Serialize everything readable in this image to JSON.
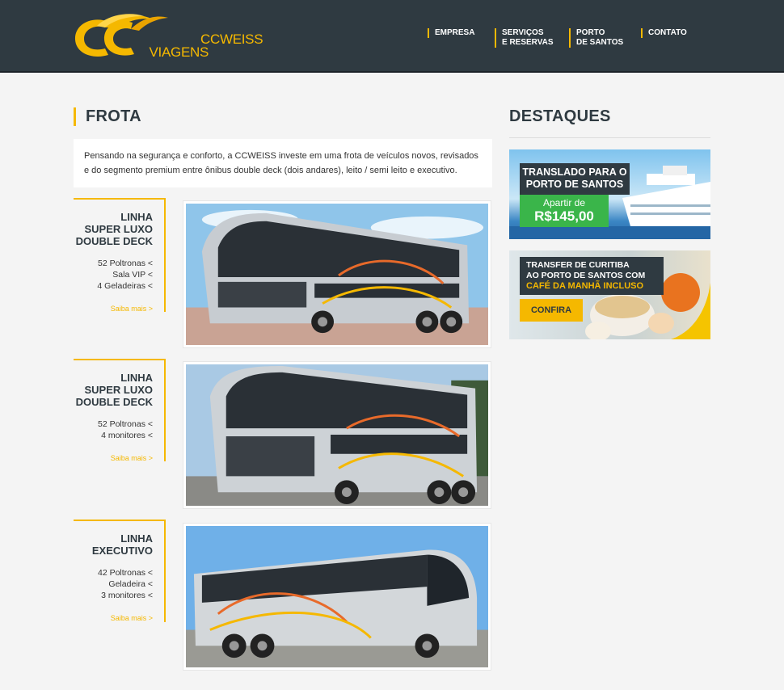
{
  "brand": {
    "logo_line1": "CCWEISS",
    "logo_line2": "VIAGENS"
  },
  "nav": [
    {
      "line1": "EMPRESA",
      "line2": ""
    },
    {
      "line1": "SERVIÇOS",
      "line2": "E RESERVAS"
    },
    {
      "line1": "PORTO",
      "line2": "DE SANTOS"
    },
    {
      "line1": "CONTATO",
      "line2": ""
    }
  ],
  "frota": {
    "title": "FROTA",
    "intro": "Pensando na segurança e conforto, a CCWEISS investe em uma frota de veículos novos, revisados e do segmento premium entre ônibus double deck (dois andares), leito / semi leito e executivo.",
    "items": [
      {
        "name": [
          "LINHA",
          "SUPER LUXO",
          "DOUBLE DECK"
        ],
        "features": [
          "52 Poltronas <",
          "Sala VIP <",
          "4 Geladeiras <"
        ],
        "more": "Saiba mais >"
      },
      {
        "name": [
          "LINHA",
          "SUPER LUXO",
          "DOUBLE DECK"
        ],
        "features": [
          "52 Poltronas <",
          "4 monitores <"
        ],
        "more": "Saiba mais >"
      },
      {
        "name": [
          "LINHA",
          "EXECUTIVO"
        ],
        "features": [
          "42 Poltronas <",
          "Geladeira <",
          "3 monitores <"
        ],
        "more": "Saiba mais >"
      }
    ]
  },
  "destaques": {
    "title": "DESTAQUES",
    "banner1": {
      "title_line1": "TRANSLADO PARA O",
      "title_line2": "PORTO DE SANTOS",
      "price_label": "Apartir de",
      "price": "R$145,00"
    },
    "banner2": {
      "line1": "TRANSFER DE CURITIBA",
      "line2": "AO PORTO DE SANTOS COM",
      "line3": "CAFÉ DA MANHÃ INCLUSO",
      "button": "CONFIRA"
    }
  },
  "colors": {
    "header": "#2f3a41",
    "accent": "#f5b800",
    "green": "#3ab54a",
    "background": "#f4f4f4"
  }
}
